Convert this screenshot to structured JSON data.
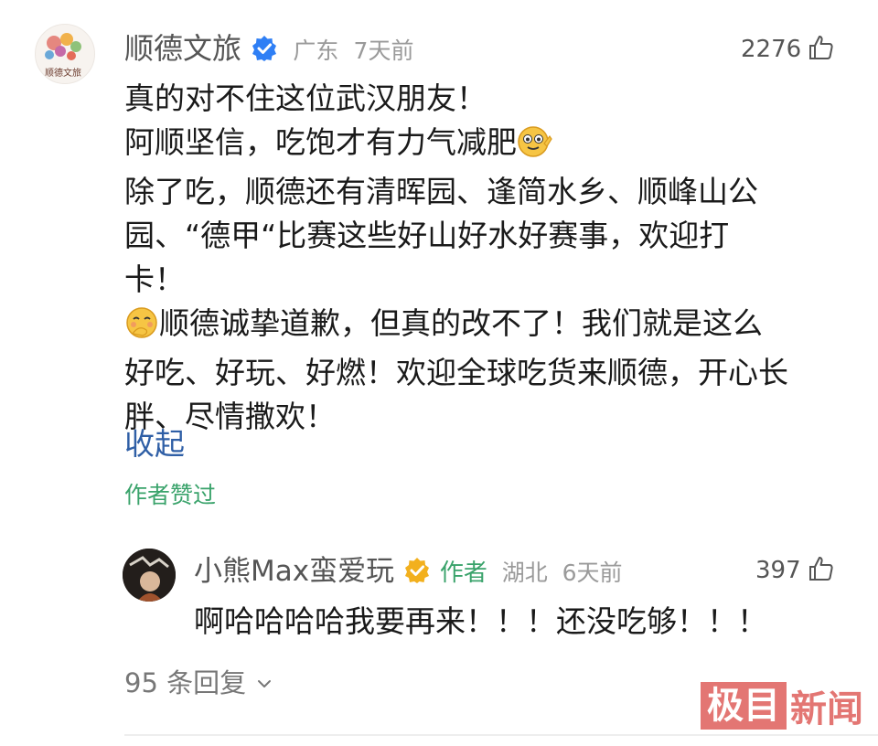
{
  "comment": {
    "author": "顺德文旅",
    "avatar_text": "顺德文旅",
    "location": "广东",
    "time": "7天前",
    "likes": "2276",
    "lines": [
      "真的对不住这位武汉朋友！",
      "阿顺坚信，吃饱才有力气减肥",
      "除了吃，顺德还有清晖园、逢简水乡、顺峰山公",
      "园、“德甲“比赛这些好山好水好赛事，欢迎打",
      "卡！",
      "顺德诚挚道歉，但真的改不了！我们就是这么",
      "好吃、好玩、好燃！欢迎全球吃货来顺德，开心长",
      "胖、尽情撒欢！"
    ],
    "collapse_label": "收起",
    "liked_by_author": "作者赞过"
  },
  "reply": {
    "author": "小熊Max蛮爱玩",
    "author_tag": "作者",
    "location": "湖北",
    "time": "6天前",
    "likes": "397",
    "text": "啊哈哈哈哈我要再来！！！还没吃够！！！"
  },
  "more_replies": "95 条回复",
  "watermark": {
    "boxed": "极目",
    "rest": "新闻"
  },
  "colors": {
    "link_blue": "#2f5fa6",
    "green": "#3aa36b",
    "verified_blue": "#2f7ff5",
    "verified_gold": "#f2b01e",
    "watermark_red": "#e06864"
  },
  "icons": [
    "verified-icon",
    "thumbs-up-icon",
    "emoji-grin-icon",
    "emoji-shy-icon",
    "chevron-down-icon"
  ]
}
